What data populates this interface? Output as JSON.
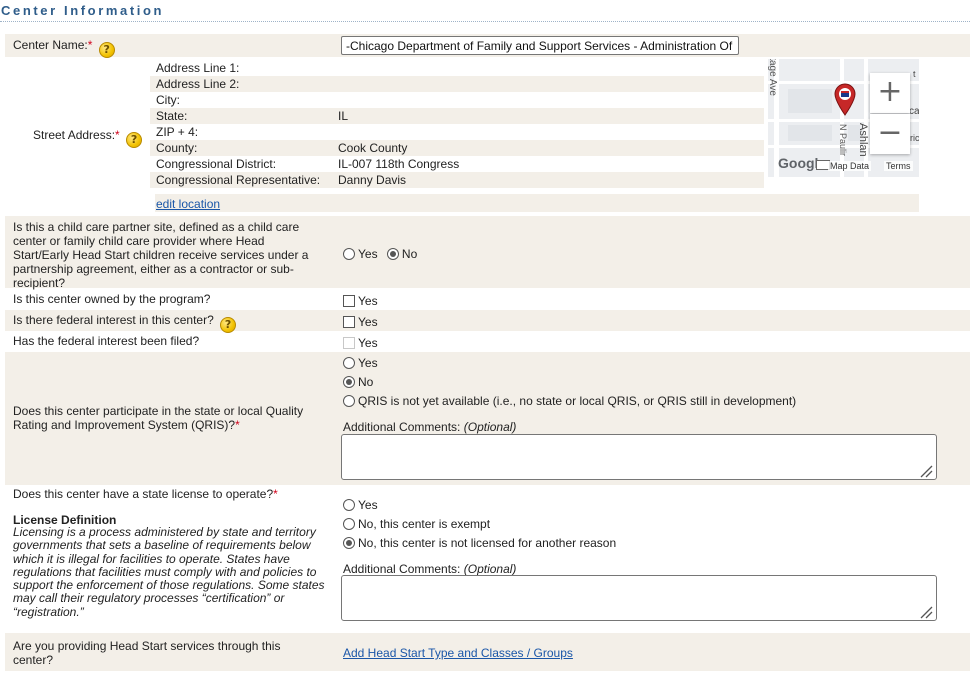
{
  "section_title": "Center Information",
  "center_name": {
    "label": "Center Name:",
    "required_mark": "*",
    "value": "-Chicago Department of Family and Support Services - Administration Of"
  },
  "street_address": {
    "label": "Street Address:",
    "required_mark": "*",
    "fields": [
      {
        "label": "Address Line 1:",
        "value": ""
      },
      {
        "label": "Address Line 2:",
        "value": ""
      },
      {
        "label": "City:",
        "value": ""
      },
      {
        "label": "State:",
        "value": "IL"
      },
      {
        "label": "ZIP + 4:",
        "value": ""
      },
      {
        "label": "County:",
        "value": "Cook County"
      },
      {
        "label": "Congressional District:",
        "value": "IL-007 118th Congress"
      },
      {
        "label": "Congressional Representative:",
        "value": "Danny Davis"
      }
    ],
    "edit_link": "edit location"
  },
  "map": {
    "street_labels": [
      "itage Ave",
      "N Paulir",
      "Ashlan",
      "ca",
      "ric",
      "t"
    ],
    "zoom_in": "+",
    "zoom_out": "−",
    "google_logo": "Google",
    "map_data": "Map Data",
    "terms": "Terms",
    "pin_color": "#c62828"
  },
  "partner_site": {
    "question": "Is this a child care partner site, defined as a child care center or family child care provider where Head Start/Early Head Start children receive services under a partnership agreement, either as a contractor or sub-recipient?",
    "options": [
      "Yes",
      "No"
    ],
    "selected": "No"
  },
  "owned": {
    "question": "Is this center owned by the program?",
    "option": "Yes",
    "checked": false
  },
  "federal_interest": {
    "question": "Is there federal interest in this center?",
    "option": "Yes",
    "checked": false
  },
  "federal_filed": {
    "question": "Has the federal interest been filed?",
    "option": "Yes",
    "checked": false,
    "disabled": true
  },
  "qris": {
    "question": "Does this center participate in the state or local Quality Rating and Improvement System (QRIS)?",
    "required_mark": "*",
    "options": [
      "Yes",
      "No",
      "QRIS is not yet available (i.e., no state or local QRIS, or QRIS still in development)"
    ],
    "selected": "No",
    "comments_label": "Additional Comments:",
    "comments_optional": "(Optional)",
    "comments_value": ""
  },
  "license": {
    "question": "Does this center have a state license to operate?",
    "required_mark": "*",
    "definition_title": "License Definition",
    "definition_text": "Licensing is a process administered by state and territory governments that sets a baseline of requirements below which it is illegal for facilities to operate. States have regulations that facilities must comply with and policies to support the enforcement of those regulations. Some states may call their regulatory processes “certification” or “registration.”",
    "options": [
      "Yes",
      "No, this center is exempt",
      "No, this center is not licensed for another reason"
    ],
    "selected": "No, this center is not licensed for another reason",
    "comments_label": "Additional Comments:",
    "comments_optional": "(Optional)",
    "comments_value": ""
  },
  "head_start": {
    "question": "Are you providing Head Start services through this center?",
    "link": "Add Head Start Type and Classes / Groups"
  },
  "colors": {
    "title": "#2f5d8a",
    "row_shade": "#f3efe8",
    "link": "#1a56a8",
    "required": "#d0021b"
  }
}
